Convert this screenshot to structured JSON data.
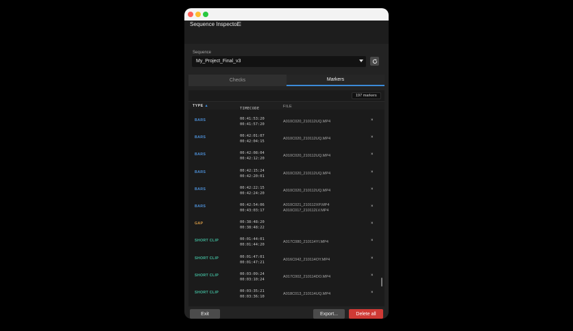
{
  "panel": {
    "title": "Sequence Inspector"
  },
  "sequence": {
    "label": "Sequence",
    "value": "My_Project_Final_v3"
  },
  "tabs": [
    {
      "label": "Checks"
    },
    {
      "label": "Markers"
    }
  ],
  "markers": {
    "count": "197 markers",
    "columns": {
      "type": "TYPE",
      "timecode": "TIMECODE",
      "file": "FILE"
    },
    "sort_indicator": "▲",
    "rows": [
      {
        "type": "BARS",
        "tc_in": "00:41:53:20",
        "tc_out": "00:41:57:20",
        "files": [
          "A010C020_210112UQ.MP4"
        ]
      },
      {
        "type": "BARS",
        "tc_in": "00:42:01:07",
        "tc_out": "00:42:04:15",
        "files": [
          "A010C020_210112UQ.MP4"
        ]
      },
      {
        "type": "BARS",
        "tc_in": "00:42:08:04",
        "tc_out": "00:42:12:20",
        "files": [
          "A010C020_210112UQ.MP4"
        ]
      },
      {
        "type": "BARS",
        "tc_in": "00:42:15:24",
        "tc_out": "00:42:20:01",
        "files": [
          "A010C020_210112UQ.MP4"
        ]
      },
      {
        "type": "BARS",
        "tc_in": "00:42:22:15",
        "tc_out": "00:42:24:20",
        "files": [
          "A010C020_210112UQ.MP4"
        ]
      },
      {
        "type": "BARS",
        "tc_in": "00:42:54:06",
        "tc_out": "00:43:03:17",
        "files": [
          "A010C021_210112XP.MP4",
          "A010C017_210112LV.MP4"
        ]
      },
      {
        "type": "GAP",
        "tc_in": "00:38:48:20",
        "tc_out": "00:38:48:22",
        "files": []
      },
      {
        "type": "SHORT CLIP",
        "tc_in": "00:01:44:01",
        "tc_out": "00:01:44:20",
        "files": [
          "A017C080_210114YI.MP4"
        ]
      },
      {
        "type": "SHORT CLIP",
        "tc_in": "00:01:47:01",
        "tc_out": "00:01:47:21",
        "files": [
          "A016C042_210114OY.MP4"
        ]
      },
      {
        "type": "SHORT CLIP",
        "tc_in": "00:03:09:24",
        "tc_out": "00:03:10:24",
        "files": [
          "A017C002_210114DO.MP4"
        ]
      },
      {
        "type": "SHORT CLIP",
        "tc_in": "00:03:35:21",
        "tc_out": "00:03:36:10",
        "files": [
          "A018C013_210114UQ.MP4"
        ]
      }
    ],
    "remove_glyph": "×"
  },
  "footer": {
    "exit_label": "Exit",
    "export_label": "Export...",
    "delete_label": "Delete all"
  },
  "icons": {
    "menu": "hamburger-icon",
    "refresh": "refresh-icon",
    "dropdown": "chevron-down-icon",
    "remove": "close-icon"
  },
  "colors": {
    "accent": "#3c8ad8",
    "bars": "#4d8fd6",
    "gap": "#d79a45",
    "short_clip": "#41b89b",
    "danger": "#cf3a35"
  }
}
